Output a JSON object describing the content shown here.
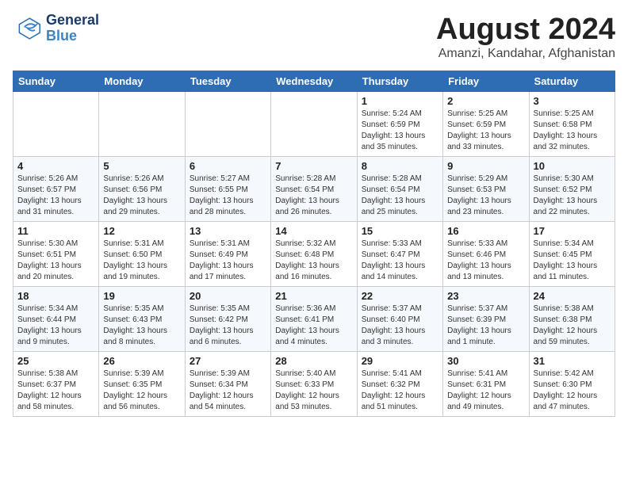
{
  "header": {
    "logo_general": "General",
    "logo_blue": "Blue",
    "month_title": "August 2024",
    "subtitle": "Amanzi, Kandahar, Afghanistan"
  },
  "days_of_week": [
    "Sunday",
    "Monday",
    "Tuesday",
    "Wednesday",
    "Thursday",
    "Friday",
    "Saturday"
  ],
  "weeks": [
    [
      {
        "day": "",
        "info": ""
      },
      {
        "day": "",
        "info": ""
      },
      {
        "day": "",
        "info": ""
      },
      {
        "day": "",
        "info": ""
      },
      {
        "day": "1",
        "info": "Sunrise: 5:24 AM\nSunset: 6:59 PM\nDaylight: 13 hours\nand 35 minutes."
      },
      {
        "day": "2",
        "info": "Sunrise: 5:25 AM\nSunset: 6:59 PM\nDaylight: 13 hours\nand 33 minutes."
      },
      {
        "day": "3",
        "info": "Sunrise: 5:25 AM\nSunset: 6:58 PM\nDaylight: 13 hours\nand 32 minutes."
      }
    ],
    [
      {
        "day": "4",
        "info": "Sunrise: 5:26 AM\nSunset: 6:57 PM\nDaylight: 13 hours\nand 31 minutes."
      },
      {
        "day": "5",
        "info": "Sunrise: 5:26 AM\nSunset: 6:56 PM\nDaylight: 13 hours\nand 29 minutes."
      },
      {
        "day": "6",
        "info": "Sunrise: 5:27 AM\nSunset: 6:55 PM\nDaylight: 13 hours\nand 28 minutes."
      },
      {
        "day": "7",
        "info": "Sunrise: 5:28 AM\nSunset: 6:54 PM\nDaylight: 13 hours\nand 26 minutes."
      },
      {
        "day": "8",
        "info": "Sunrise: 5:28 AM\nSunset: 6:54 PM\nDaylight: 13 hours\nand 25 minutes."
      },
      {
        "day": "9",
        "info": "Sunrise: 5:29 AM\nSunset: 6:53 PM\nDaylight: 13 hours\nand 23 minutes."
      },
      {
        "day": "10",
        "info": "Sunrise: 5:30 AM\nSunset: 6:52 PM\nDaylight: 13 hours\nand 22 minutes."
      }
    ],
    [
      {
        "day": "11",
        "info": "Sunrise: 5:30 AM\nSunset: 6:51 PM\nDaylight: 13 hours\nand 20 minutes."
      },
      {
        "day": "12",
        "info": "Sunrise: 5:31 AM\nSunset: 6:50 PM\nDaylight: 13 hours\nand 19 minutes."
      },
      {
        "day": "13",
        "info": "Sunrise: 5:31 AM\nSunset: 6:49 PM\nDaylight: 13 hours\nand 17 minutes."
      },
      {
        "day": "14",
        "info": "Sunrise: 5:32 AM\nSunset: 6:48 PM\nDaylight: 13 hours\nand 16 minutes."
      },
      {
        "day": "15",
        "info": "Sunrise: 5:33 AM\nSunset: 6:47 PM\nDaylight: 13 hours\nand 14 minutes."
      },
      {
        "day": "16",
        "info": "Sunrise: 5:33 AM\nSunset: 6:46 PM\nDaylight: 13 hours\nand 13 minutes."
      },
      {
        "day": "17",
        "info": "Sunrise: 5:34 AM\nSunset: 6:45 PM\nDaylight: 13 hours\nand 11 minutes."
      }
    ],
    [
      {
        "day": "18",
        "info": "Sunrise: 5:34 AM\nSunset: 6:44 PM\nDaylight: 13 hours\nand 9 minutes."
      },
      {
        "day": "19",
        "info": "Sunrise: 5:35 AM\nSunset: 6:43 PM\nDaylight: 13 hours\nand 8 minutes."
      },
      {
        "day": "20",
        "info": "Sunrise: 5:35 AM\nSunset: 6:42 PM\nDaylight: 13 hours\nand 6 minutes."
      },
      {
        "day": "21",
        "info": "Sunrise: 5:36 AM\nSunset: 6:41 PM\nDaylight: 13 hours\nand 4 minutes."
      },
      {
        "day": "22",
        "info": "Sunrise: 5:37 AM\nSunset: 6:40 PM\nDaylight: 13 hours\nand 3 minutes."
      },
      {
        "day": "23",
        "info": "Sunrise: 5:37 AM\nSunset: 6:39 PM\nDaylight: 13 hours\nand 1 minute."
      },
      {
        "day": "24",
        "info": "Sunrise: 5:38 AM\nSunset: 6:38 PM\nDaylight: 12 hours\nand 59 minutes."
      }
    ],
    [
      {
        "day": "25",
        "info": "Sunrise: 5:38 AM\nSunset: 6:37 PM\nDaylight: 12 hours\nand 58 minutes."
      },
      {
        "day": "26",
        "info": "Sunrise: 5:39 AM\nSunset: 6:35 PM\nDaylight: 12 hours\nand 56 minutes."
      },
      {
        "day": "27",
        "info": "Sunrise: 5:39 AM\nSunset: 6:34 PM\nDaylight: 12 hours\nand 54 minutes."
      },
      {
        "day": "28",
        "info": "Sunrise: 5:40 AM\nSunset: 6:33 PM\nDaylight: 12 hours\nand 53 minutes."
      },
      {
        "day": "29",
        "info": "Sunrise: 5:41 AM\nSunset: 6:32 PM\nDaylight: 12 hours\nand 51 minutes."
      },
      {
        "day": "30",
        "info": "Sunrise: 5:41 AM\nSunset: 6:31 PM\nDaylight: 12 hours\nand 49 minutes."
      },
      {
        "day": "31",
        "info": "Sunrise: 5:42 AM\nSunset: 6:30 PM\nDaylight: 12 hours\nand 47 minutes."
      }
    ]
  ]
}
